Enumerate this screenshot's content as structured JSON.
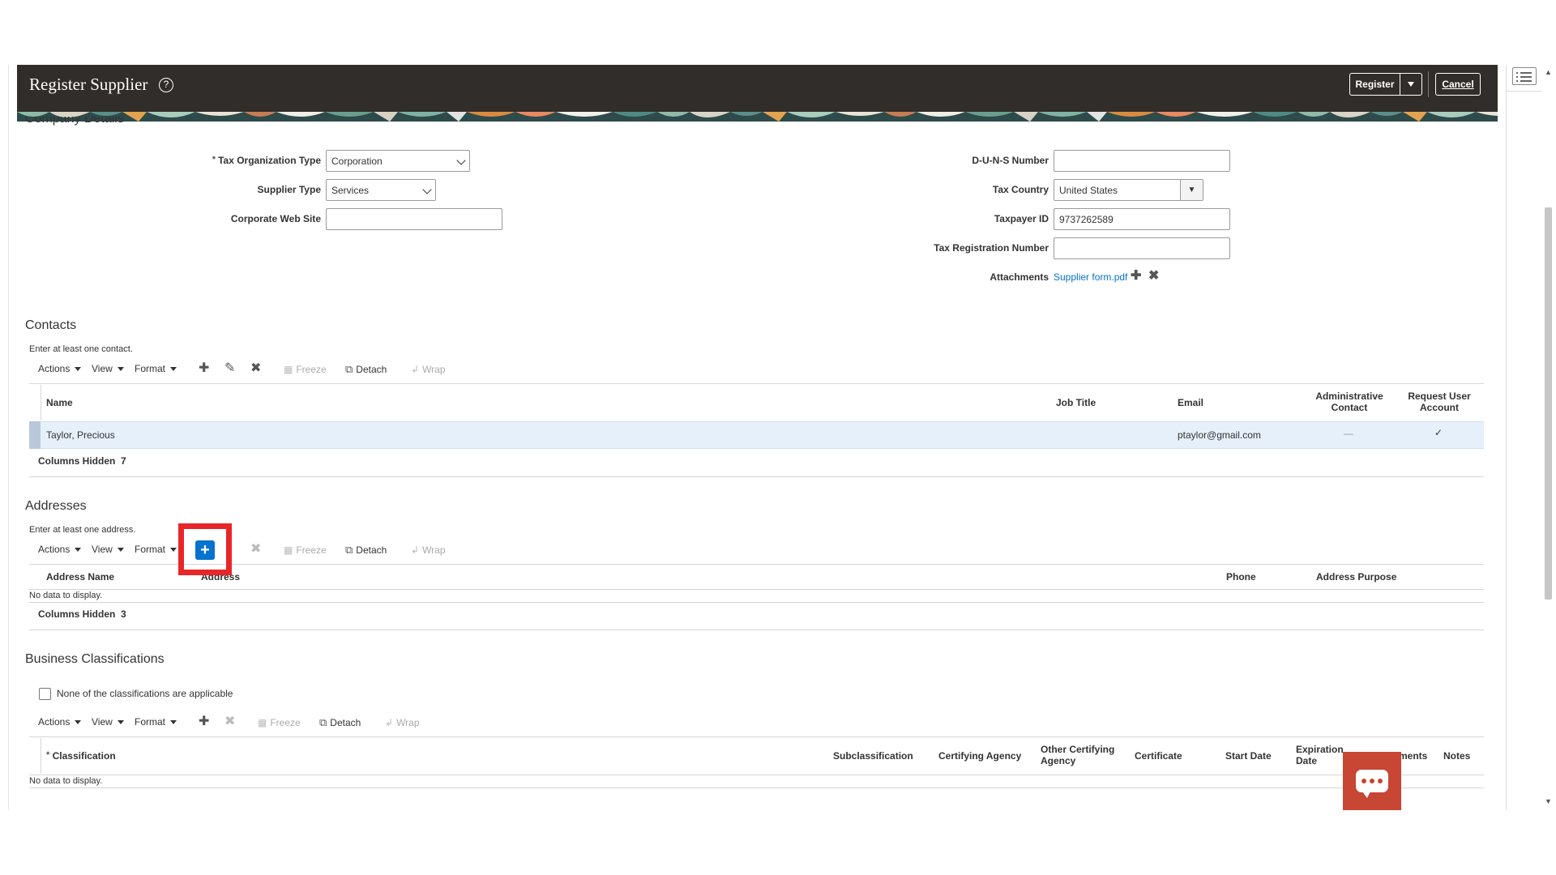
{
  "header": {
    "title": "Register Supplier",
    "register_label": "Register",
    "cancel_label": "Cancel"
  },
  "company": {
    "section_title": "Company Details",
    "tax_org_type_label": "Tax Organization Type",
    "tax_org_type_value": "Corporation",
    "supplier_type_label": "Supplier Type",
    "supplier_type_value": "Services",
    "web_site_label": "Corporate Web Site",
    "web_site_value": "",
    "duns_label": "D-U-N-S Number",
    "duns_value": "",
    "tax_country_label": "Tax Country",
    "tax_country_value": "United States",
    "taxpayer_id_label": "Taxpayer ID",
    "taxpayer_id_value": "9737262589",
    "tax_reg_label": "Tax Registration Number",
    "tax_reg_value": "",
    "attachments_label": "Attachments",
    "attachment_file": "Supplier form.pdf"
  },
  "toolbar": {
    "actions": "Actions",
    "view": "View",
    "format": "Format",
    "freeze": "Freeze",
    "detach": "Detach",
    "wrap": "Wrap"
  },
  "contacts": {
    "section_title": "Contacts",
    "hint": "Enter at least one contact.",
    "columns": {
      "name": "Name",
      "job_title": "Job Title",
      "email": "Email",
      "admin_contact_1": "Administrative",
      "admin_contact_2": "Contact",
      "request_account_1": "Request User",
      "request_account_2": "Account"
    },
    "rows": [
      {
        "name": "Taylor, Precious",
        "job_title": "",
        "email": "ptaylor@gmail.com",
        "admin_contact": "—",
        "request_account": "✓"
      }
    ],
    "columns_hidden_label": "Columns Hidden",
    "columns_hidden_count": "7"
  },
  "addresses": {
    "section_title": "Addresses",
    "hint": "Enter at least one address.",
    "columns": {
      "address_name": "Address Name",
      "address": "Address",
      "phone": "Phone",
      "address_purpose": "Address Purpose"
    },
    "empty_text": "No data to display.",
    "columns_hidden_label": "Columns Hidden",
    "columns_hidden_count": "3"
  },
  "classifications": {
    "section_title": "Business Classifications",
    "none_applicable_label": "None of the classifications are applicable",
    "columns": {
      "classification": "Classification",
      "subclassification": "Subclassification",
      "certifying_agency": "Certifying Agency",
      "other_agency_1": "Other Certifying",
      "other_agency_2": "Agency",
      "certificate": "Certificate",
      "start_date": "Start Date",
      "expiration_1": "Expiration",
      "expiration_2": "Date",
      "attachments_partial": "ments",
      "notes": "Notes"
    },
    "empty_text": "No data to display."
  },
  "colors": {
    "header_bg": "#312d2a",
    "accent_blue": "#0572ce",
    "highlight_red": "#e8262a",
    "chat_bg": "#c74634"
  }
}
